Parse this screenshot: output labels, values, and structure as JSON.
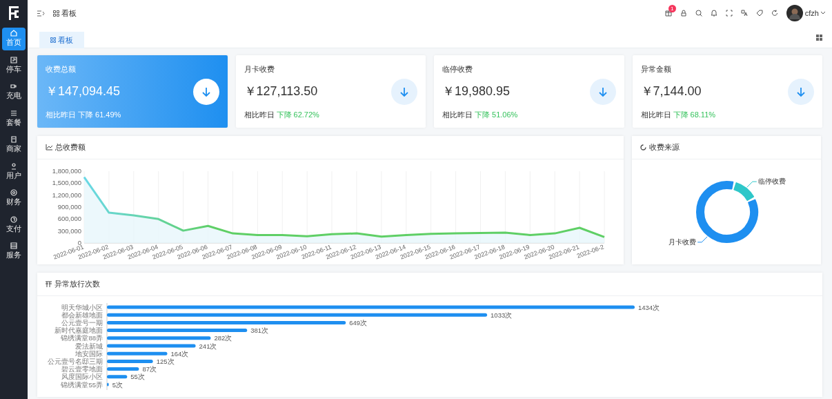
{
  "sidebar": {
    "items": [
      {
        "label": "首页",
        "selected": true
      },
      {
        "label": "停车",
        "selected": false
      },
      {
        "label": "充电",
        "selected": false
      },
      {
        "label": "套餐",
        "selected": false
      },
      {
        "label": "商家",
        "selected": false
      },
      {
        "label": "用户",
        "selected": false
      },
      {
        "label": "财务",
        "selected": false
      },
      {
        "label": "支付",
        "selected": false
      },
      {
        "label": "服务",
        "selected": false
      }
    ]
  },
  "header": {
    "breadcrumb": "看板",
    "notification_count": "1",
    "username": "cfzh"
  },
  "tabs": [
    {
      "label": "看板",
      "selected": true
    }
  ],
  "stat_cards": [
    {
      "title": "收费总额",
      "amount": "￥147,094.45",
      "compare_label": "相比昨日",
      "change": "下降 61.49%",
      "highlighted": true
    },
    {
      "title": "月卡收费",
      "amount": "￥127,113.50",
      "compare_label": "相比昨日",
      "change": "下降 62.72%",
      "highlighted": false
    },
    {
      "title": "临停收费",
      "amount": "￥19,980.95",
      "compare_label": "相比昨日",
      "change": "下降 51.06%",
      "highlighted": false
    },
    {
      "title": "异常金额",
      "amount": "￥7,144.00",
      "compare_label": "相比昨日",
      "change": "下降 68.11%",
      "highlighted": false
    }
  ],
  "line_panel": {
    "title": "总收费额",
    "chart_data": {
      "type": "area",
      "categories": [
        "2022-06-01",
        "2022-06-02",
        "2022-06-03",
        "2022-06-04",
        "2022-06-05",
        "2022-06-06",
        "2022-06-07",
        "2022-06-08",
        "2022-06-09",
        "2022-06-10",
        "2022-06-11",
        "2022-06-12",
        "2022-06-13",
        "2022-06-14",
        "2022-06-15",
        "2022-06-16",
        "2022-06-17",
        "2022-06-18",
        "2022-06-19",
        "2022-06-20",
        "2022-06-21",
        "2022-06-2"
      ],
      "grid": true,
      "series": [
        {
          "color": "#5fcf65",
          "values": [
            1650000,
            760000,
            690000,
            600000,
            310000,
            430000,
            240000,
            200000,
            200000,
            170000,
            220000,
            240000,
            160000,
            200000,
            230000,
            240000,
            250000,
            260000,
            200000,
            240000,
            380000,
            150000
          ]
        }
      ],
      "ylim": [
        0,
        1800000
      ],
      "yticks": [
        {
          "value": 0,
          "label": "0"
        },
        {
          "value": 300000,
          "label": "300,000"
        },
        {
          "value": 600000,
          "label": "600,000"
        },
        {
          "value": 900000,
          "label": "900,000"
        },
        {
          "value": 1200000,
          "label": "1,200,000"
        },
        {
          "value": 1500000,
          "label": "1,500,000"
        },
        {
          "value": 1800000,
          "label": "1,800,000"
        }
      ]
    }
  },
  "donut_panel": {
    "title": "收费来源",
    "chart_data": {
      "type": "donut",
      "categories": [
        "临停收费",
        "月卡收费"
      ],
      "series": [
        {
          "values": [
            13.58,
            86.42
          ]
        }
      ],
      "colors": [
        "#2ec7c9",
        "#1e8ff0"
      ]
    }
  },
  "bar_panel": {
    "title": "异常放行次数",
    "value_units": [
      "次",
      "次",
      "次",
      "次",
      "次",
      "次",
      "次",
      "次",
      "次",
      "次",
      "次"
    ],
    "chart_data": {
      "type": "bar",
      "orientation": "horizontal",
      "categories": [
        "明天华城小区",
        "都会新雄地面",
        "公元壹号一期",
        "新时代嘉庭地面",
        "锦绣满堂88弄",
        "爱法新城",
        "地安国际",
        "公元壹号名邸三期",
        "碧云壹零地面",
        "风度国际小区",
        "锦绣满堂55弄"
      ],
      "data_labels": true,
      "series": [
        {
          "color": "#1e8ff0",
          "values": [
            1434,
            1033,
            649,
            381,
            282,
            241,
            164,
            125,
            87,
            55,
            5
          ]
        }
      ]
    }
  }
}
